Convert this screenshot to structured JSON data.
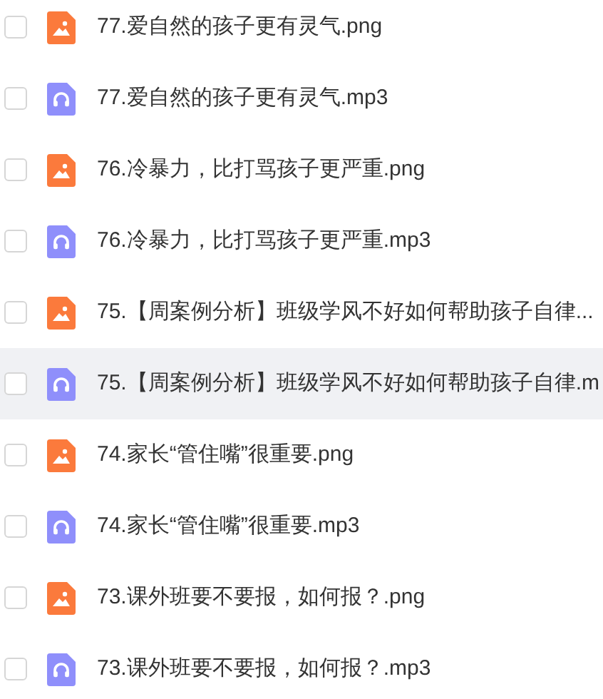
{
  "files": [
    {
      "name": "77.爱自然的孩子更有灵气.png",
      "kind": "image",
      "checked": false,
      "highlighted": false
    },
    {
      "name": "77.爱自然的孩子更有灵气.mp3",
      "kind": "audio",
      "checked": false,
      "highlighted": false
    },
    {
      "name": "76.冷暴力，比打骂孩子更严重.png",
      "kind": "image",
      "checked": false,
      "highlighted": false
    },
    {
      "name": "76.冷暴力，比打骂孩子更严重.mp3",
      "kind": "audio",
      "checked": false,
      "highlighted": false
    },
    {
      "name": "75.【周案例分析】班级学风不好如何帮助孩子自律...",
      "kind": "image",
      "checked": false,
      "highlighted": false
    },
    {
      "name": "75.【周案例分析】班级学风不好如何帮助孩子自律.m",
      "kind": "audio",
      "checked": false,
      "highlighted": true
    },
    {
      "name": "74.家长“管住嘴”很重要.png",
      "kind": "image",
      "checked": false,
      "highlighted": false
    },
    {
      "name": "74.家长“管住嘴”很重要.mp3",
      "kind": "audio",
      "checked": false,
      "highlighted": false
    },
    {
      "name": "73.课外班要不要报，如何报？.png",
      "kind": "image",
      "checked": false,
      "highlighted": false
    },
    {
      "name": "73.课外班要不要报，如何报？.mp3",
      "kind": "audio",
      "checked": false,
      "highlighted": false
    }
  ]
}
